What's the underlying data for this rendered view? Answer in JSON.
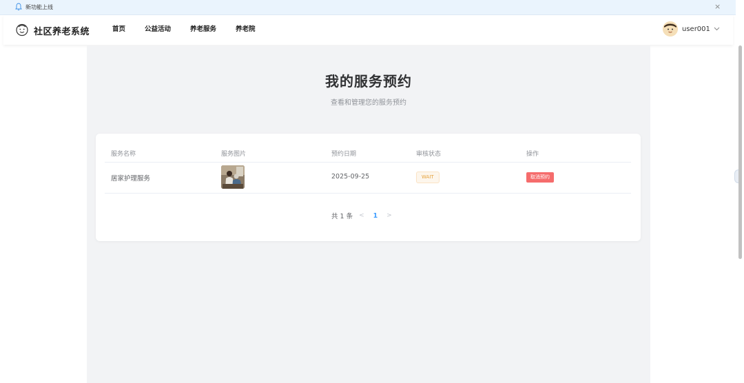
{
  "notice": {
    "text": "新功能上线",
    "close_glyph": "×"
  },
  "header": {
    "logo_text": "社区养老系统",
    "nav": [
      {
        "label": "首页"
      },
      {
        "label": "公益活动"
      },
      {
        "label": "养老服务"
      },
      {
        "label": "养老院"
      }
    ],
    "user": {
      "name": "user001"
    }
  },
  "page": {
    "title": "我的服务预约",
    "subtitle": "查看和管理您的服务预约"
  },
  "table": {
    "columns": [
      "服务名称",
      "服务图片",
      "预约日期",
      "审核状态",
      "操作"
    ],
    "rows": [
      {
        "service_name": "居家护理服务",
        "date": "2025-09-25",
        "status": "WAIT",
        "action_label": "取消预约"
      }
    ]
  },
  "pagination": {
    "total_label": "共 1 条",
    "current_page": "1"
  },
  "colors": {
    "accent": "#409eff",
    "danger": "#f56c6c",
    "warning": "#e6a23c",
    "notice_bg": "#eaf4fd",
    "main_bg": "#f2f3f5"
  }
}
